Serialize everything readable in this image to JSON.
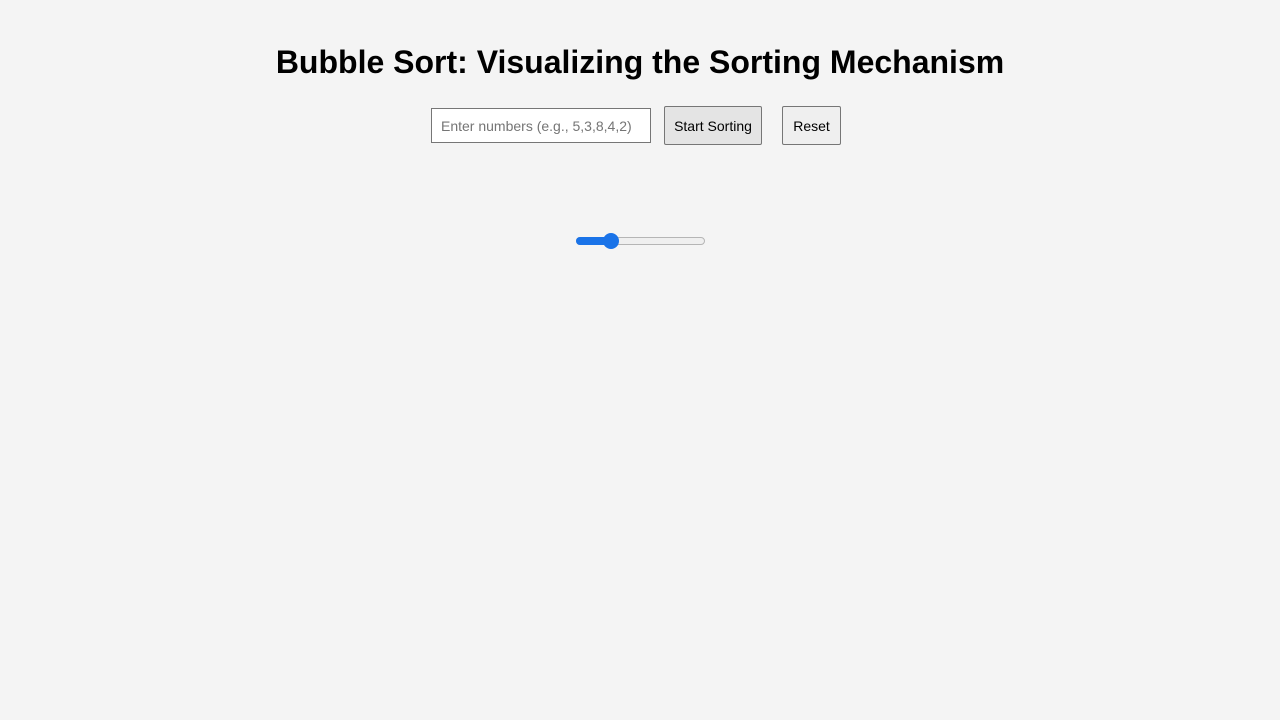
{
  "page": {
    "title": "Bubble Sort: Visualizing the Sorting Mechanism"
  },
  "controls": {
    "input": {
      "value": "",
      "placeholder": "Enter numbers (e.g., 5,3,8,4,2)"
    },
    "start_label": "Start Sorting",
    "reset_label": "Reset"
  },
  "speed_slider": {
    "fraction": 0.24,
    "accent_color": "#1a73e8"
  },
  "colors": {
    "background": "#f4f4f4",
    "accent": "#1a73e8"
  }
}
